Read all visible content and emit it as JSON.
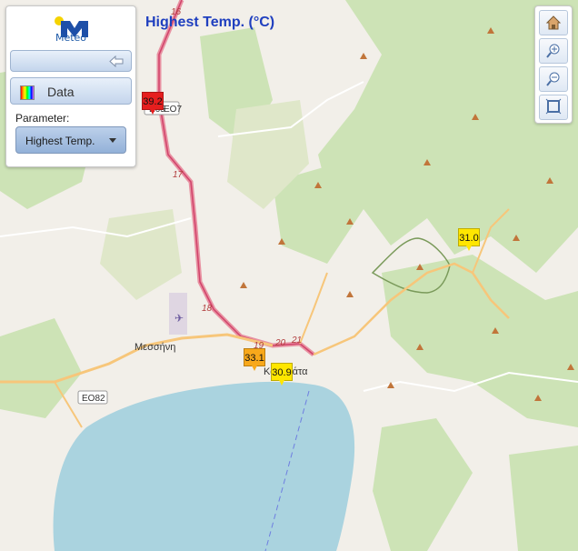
{
  "logo": {
    "text": "Meteo"
  },
  "title": "Highest Temp. (°C)",
  "panel": {
    "data_button_label": "Data",
    "parameter_label": "Parameter:",
    "parameter_value": "Highest Temp."
  },
  "map": {
    "place_labels": [
      "Μεσσήνη",
      "Καλαμάτα"
    ],
    "road_shields": [
      "E65",
      "EO7",
      "EO82"
    ],
    "road_numbers": [
      "16",
      "17",
      "18",
      "19",
      "20",
      "21"
    ],
    "sea_color": "#aad3df",
    "land_color": "#f2efe9",
    "forest_color": "#cde3b6"
  },
  "markers": [
    {
      "value": "39.2",
      "color": "#e61e1e"
    },
    {
      "value": "31.0",
      "color": "#ffe600"
    },
    {
      "value": "33.1",
      "color": "#f8a81b"
    },
    {
      "value": "30.9",
      "color": "#ffe600"
    }
  ],
  "zoom_controls": [
    "home-icon",
    "zoom-in-icon",
    "zoom-out-icon",
    "zoom-extent-icon"
  ]
}
